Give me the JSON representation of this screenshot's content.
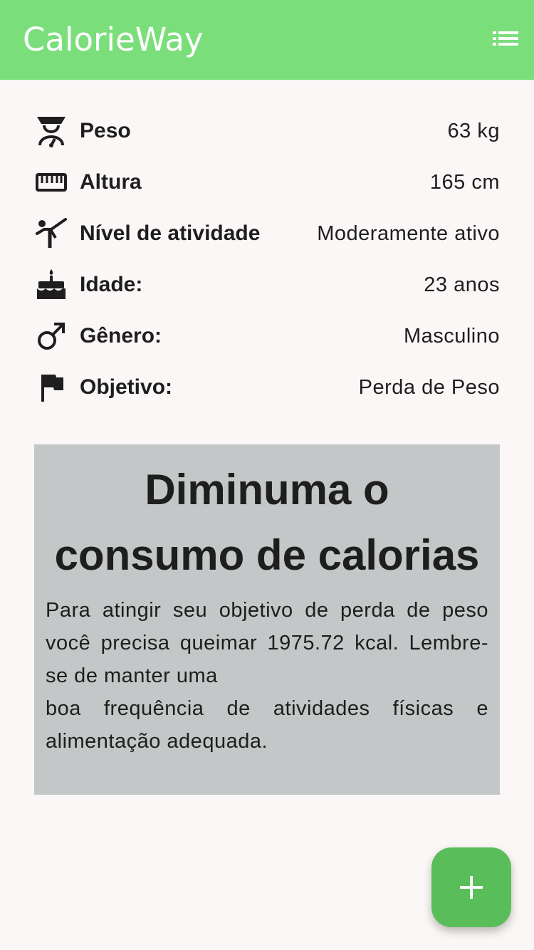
{
  "app": {
    "title": "CalorieWay",
    "accent_color": "#7ade7a",
    "fab_color": "#59bd59"
  },
  "appbar": {
    "menu_icon": "list-icon"
  },
  "profile": {
    "rows": [
      {
        "icon": "scale-icon",
        "label": "Peso",
        "value": "63 kg"
      },
      {
        "icon": "ruler-icon",
        "label": "Altura",
        "value": "165 cm"
      },
      {
        "icon": "activity-icon",
        "label": "Nível de atividade",
        "value": "Moderamente ativo"
      },
      {
        "icon": "cake-icon",
        "label": "Idade:",
        "value": "23 anos"
      },
      {
        "icon": "male-icon",
        "label": "Gênero:",
        "value": "Masculino"
      },
      {
        "icon": "flag-icon",
        "label": "Objetivo:",
        "value": "Perda de Peso"
      }
    ]
  },
  "tip": {
    "title": "Diminuma o consumo de calorias",
    "body_part1": "Para atingir seu objetivo de perda de peso você precisa queimar 1975.72 kcal. Lembre-se de manter uma",
    "body_part2": "boa frequência de atividades físicas e alimentação adequada."
  },
  "fab": {
    "icon": "plus-icon"
  }
}
